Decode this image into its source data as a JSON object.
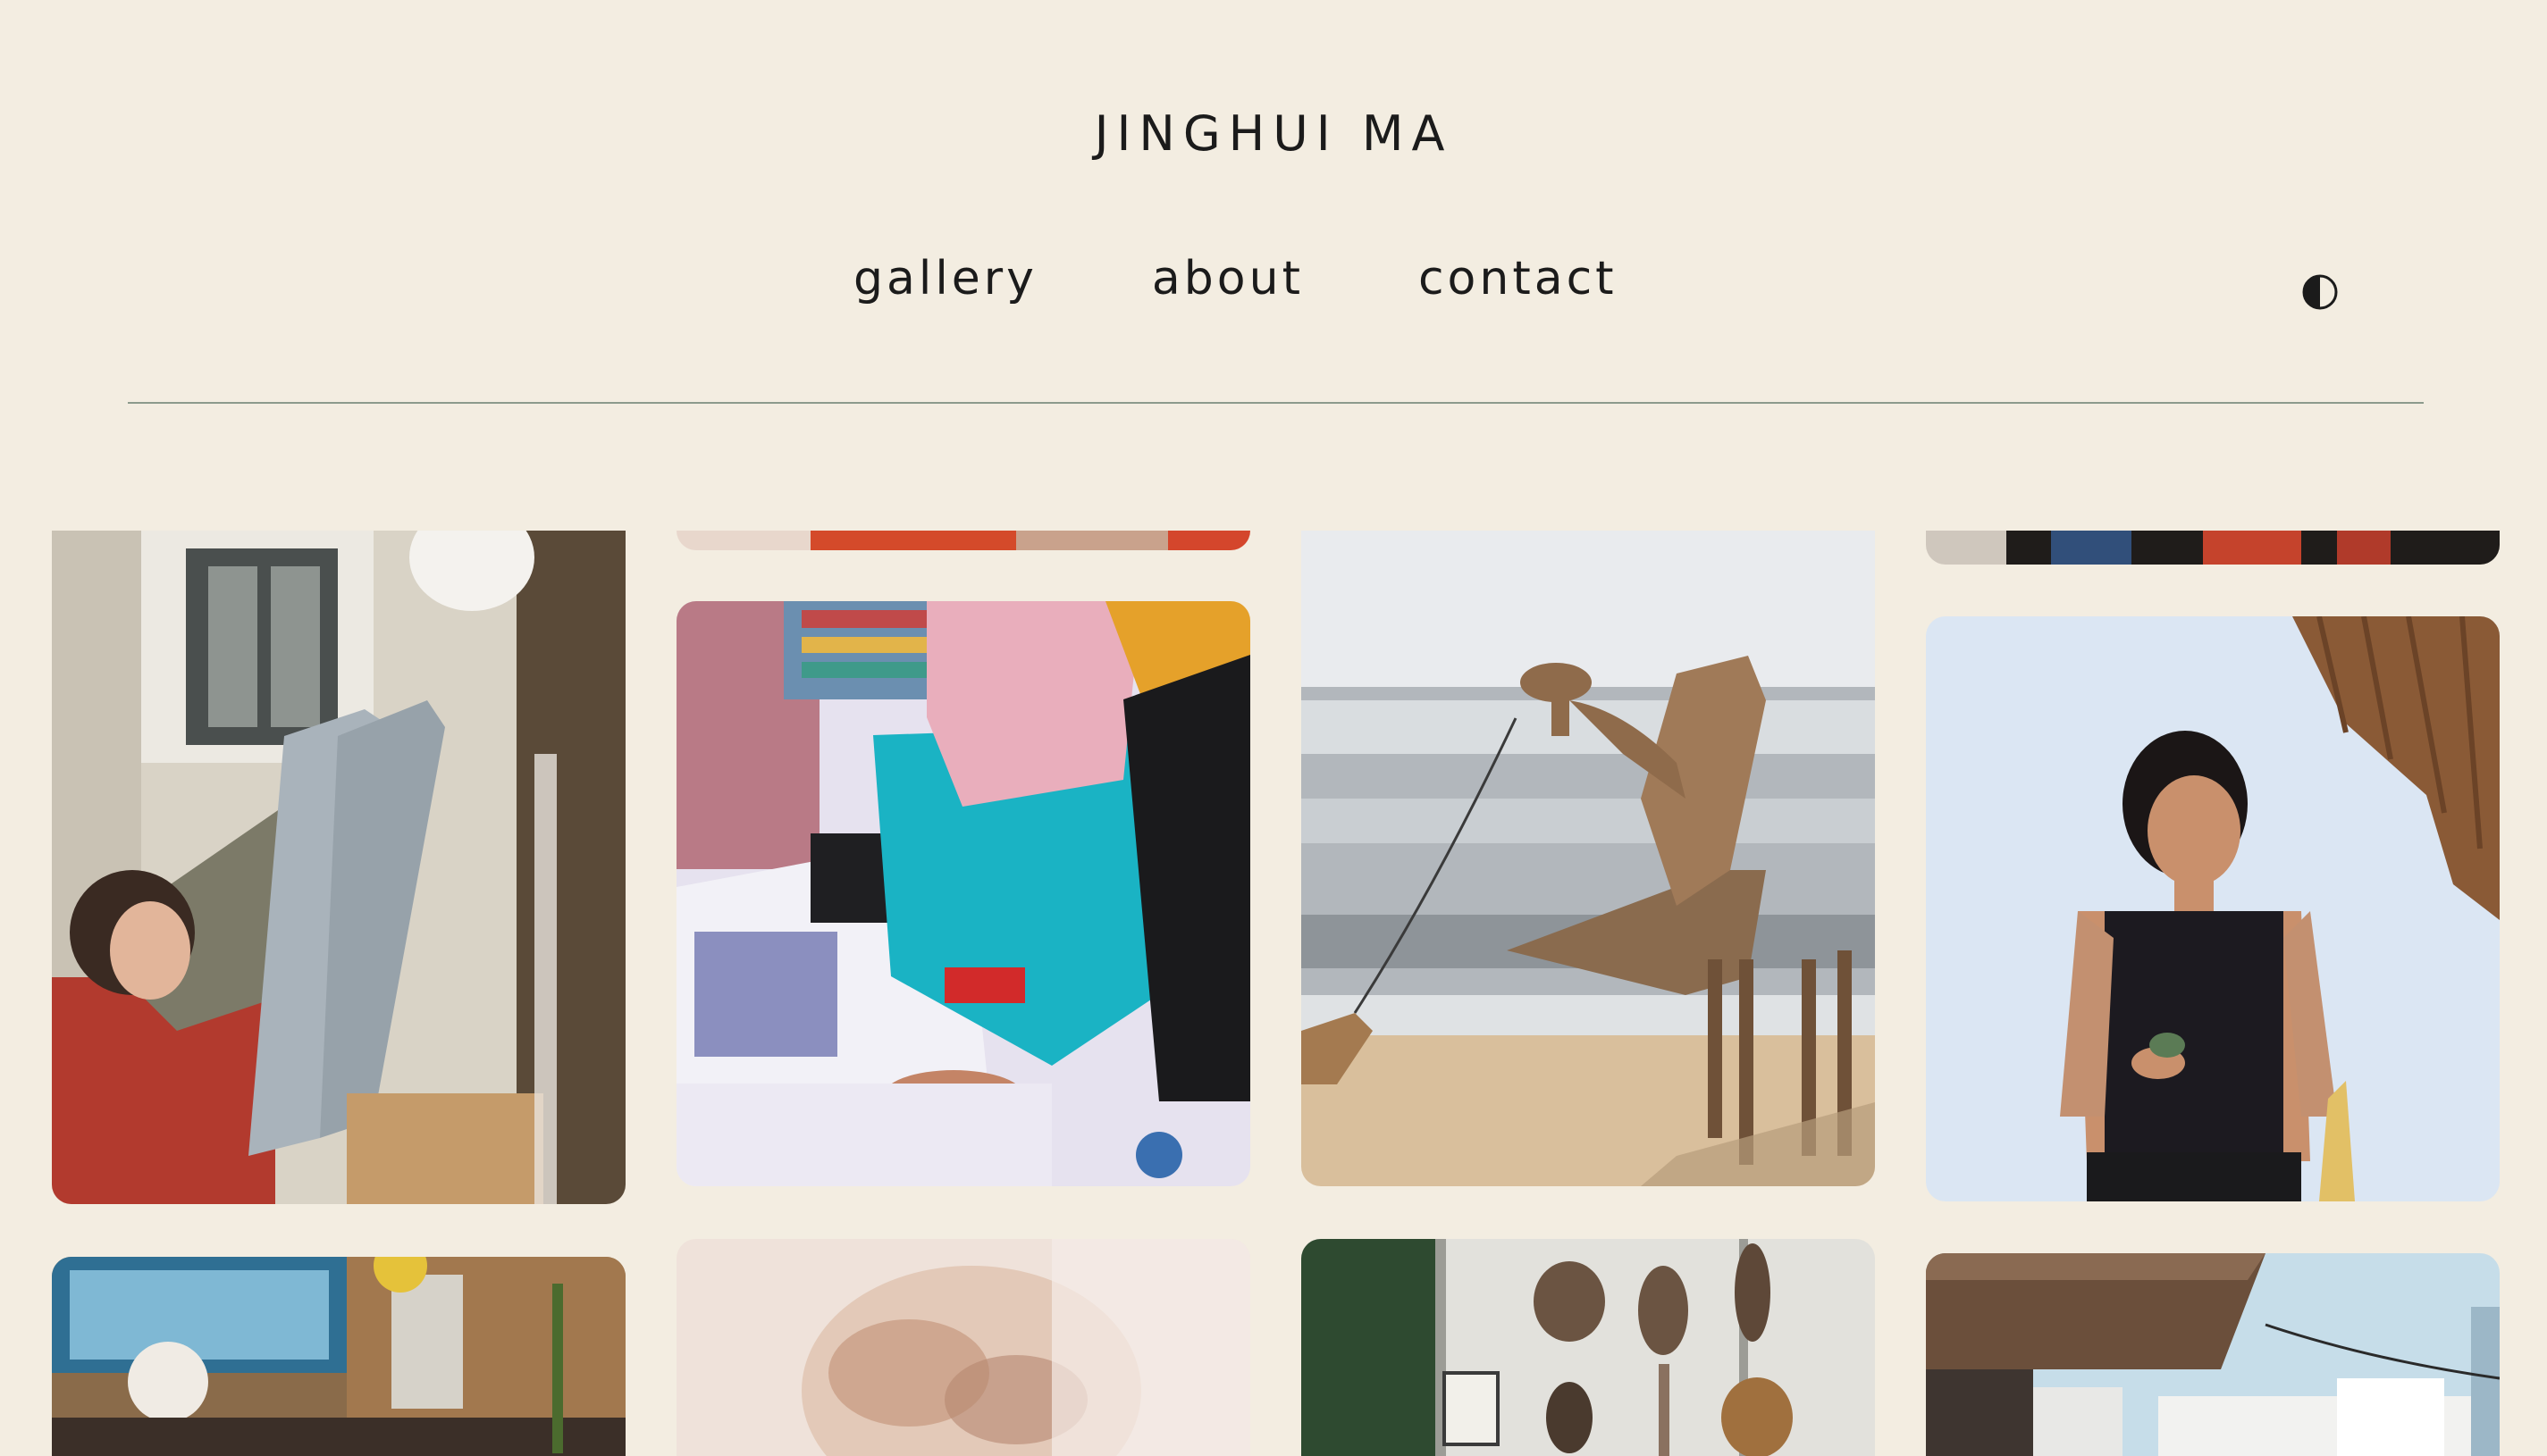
{
  "header": {
    "title": "JINGHUI MA"
  },
  "nav": {
    "items": [
      {
        "label": "gallery"
      },
      {
        "label": "about"
      },
      {
        "label": "contact"
      }
    ],
    "theme_toggle_icon": "half-circle-contrast-icon"
  },
  "colors": {
    "background": "#f3ede1",
    "text": "#1b1b1b",
    "divider": "#8c9a8c"
  },
  "gallery": {
    "photos": [
      {
        "name": "photo-woman-on-sofa-with-cat"
      },
      {
        "name": "photo-top-cropped-red"
      },
      {
        "name": "photo-woman-beading-bracelets"
      },
      {
        "name": "photo-camel-on-beach"
      },
      {
        "name": "photo-top-cropped-dark"
      },
      {
        "name": "photo-woman-in-swimsuit"
      },
      {
        "name": "photo-workshop-interior"
      },
      {
        "name": "photo-blurred-portrait"
      },
      {
        "name": "photo-masks-on-wall"
      },
      {
        "name": "photo-market-awning"
      }
    ]
  }
}
